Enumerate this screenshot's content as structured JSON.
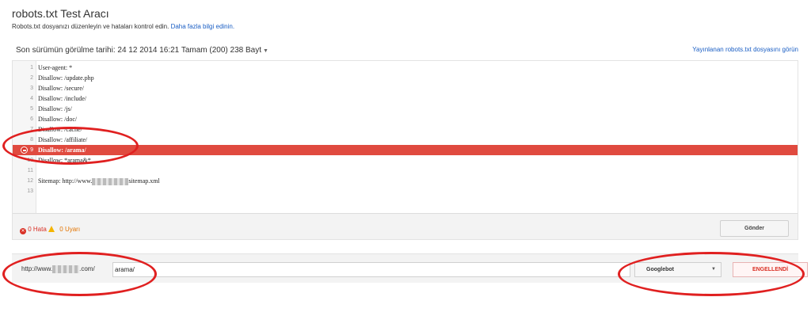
{
  "header": {
    "title": "robots.txt Test Aracı",
    "subtitle": "Robots.txt dosyanızı düzenleyin ve hataları kontrol edin.",
    "learn_more": "Daha fazla bilgi edinin."
  },
  "version": {
    "label": "Son sürümün görülme tarihi: 24 12 2014 16:21 Tamam (200) 238 Bayt",
    "published_link": "Yayınlanan robots.txt dosyasını görün"
  },
  "editor": {
    "lines": [
      {
        "num": "1",
        "code": "User-agent: *"
      },
      {
        "num": "2",
        "code": "Disallow: /update.php"
      },
      {
        "num": "3",
        "code": "Disallow: /secure/"
      },
      {
        "num": "4",
        "code": "Disallow: /include/"
      },
      {
        "num": "5",
        "code": "Disallow: /js/"
      },
      {
        "num": "6",
        "code": "Disallow: /doc/"
      },
      {
        "num": "7",
        "code": "Disallow: /cache/"
      },
      {
        "num": "8",
        "code": "Disallow: /affiliate/"
      },
      {
        "num": "9",
        "code": "Disallow: /arama/"
      },
      {
        "num": "10",
        "code": "Disallow: *arama&*"
      },
      {
        "num": "11",
        "code": ""
      },
      {
        "num": "12",
        "code_prefix": "Sitemap: http://www.",
        "code_suffix": "sitemap.xml"
      },
      {
        "num": "13",
        "code": ""
      }
    ],
    "error_line": "9"
  },
  "status": {
    "errors": "0 Hata",
    "warnings": "0 Uyarı",
    "send_button": "Gönder"
  },
  "test": {
    "url_prefix_start": "http://www.",
    "url_prefix_end": ".com/",
    "url_value": "arama/",
    "user_agent": "Googlebot",
    "result": "ENGELLENDİ"
  },
  "colors": {
    "error_row": "#e04a3f",
    "link": "#1a5ec4",
    "annotation": "#e02020"
  }
}
